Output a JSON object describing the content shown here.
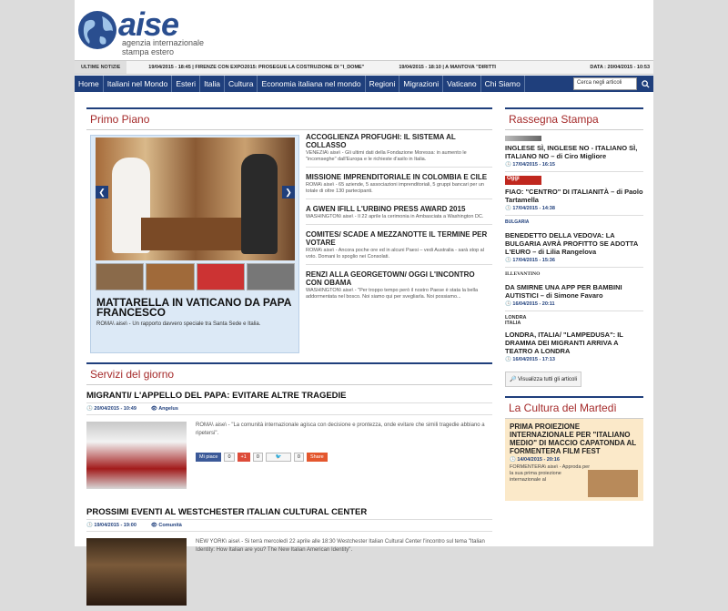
{
  "brand": {
    "name": "aise",
    "subtitle_line1": "agenzia internazionale",
    "subtitle_line2": "stampa estero"
  },
  "ticker": {
    "label": "ULTIME NOTIZIE",
    "items": [
      "19/04/2015 - 18:45 | FIRENZE CON EXPO2015: PROSEGUE LA COSTRUZIONE DI \"I_DOME\"",
      "19/04/2015 - 18:10 | A MANTOVA \"DIRITTI"
    ],
    "date_label": "DATA : 20/04/2015 - 10:53"
  },
  "nav": {
    "items": [
      "Home",
      "Italiani nel Mondo",
      "Esteri",
      "Italia",
      "Cultura",
      "Economia italiana nel mondo",
      "Regioni",
      "Migrazioni",
      "Vaticano",
      "Chi Siamo"
    ],
    "search_placeholder": "Cerca negli articoli"
  },
  "primo_piano": {
    "title": "Primo Piano",
    "featured": {
      "title": "MATTARELLA IN VATICANO DA PAPA FRANCESCO",
      "text": "ROMA\\ aise\\ - Un rapporto davvero speciale tra Santa Sede e Italia."
    },
    "news": [
      {
        "title": "ACCOGLIENZA PROFUGHI: IL SISTEMA AL COLLASSO",
        "text": "VENEZIA\\ aise\\ - Gli ultimi dati della Fondazione Moressa: in aumento le \"incomseghe\" dall'Europa e le richieste d'asilo in Italia."
      },
      {
        "title": "MISSIONE IMPRENDITORIALE IN COLOMBIA E CILE",
        "text": "ROMA\\ aise\\ - 65 aziende, 5 associazioni imprenditoriali, 5 gruppi bancari per un totale di oltre 130 partecipanti."
      },
      {
        "title": "A GWEN IFILL L'URBINO PRESS AWARD 2015",
        "text": "WASHINGTON\\ aise\\ - Il 22 aprile la cerimonia in Ambasciata a Washington DC."
      },
      {
        "title": "COMITES/ SCADE A MEZZANOTTE IL TERMINE PER VOTARE",
        "text": "ROMA\\ aise\\ - Ancora poche ore ed in alcuni Paesi – vedi Australia - sarà stop al voto. Domani lo spoglio nei Consolati."
      },
      {
        "title": "RENZI ALLA GEORGETOWN/ OGGI L'INCONTRO CON OBAMA",
        "text": "WASHINGTON\\ aise\\ - \"Per troppo tempo però il nostro Paese è stata la bella addormentata nel bosco. Noi siamo qui per svegliarla. Noi possiamo..."
      }
    ]
  },
  "servizi": {
    "title": "Servizi del giorno",
    "articles": [
      {
        "title": "MIGRANTI/ L'APPELLO DEL PAPA: EVITARE ALTRE TRAGEDIE",
        "date": "20/04/2015 - 10:49",
        "author": "Angelus",
        "text": "ROMA\\ aise\\ - \"La comunità internazionale agisca con decisione e prontezza, onde evitare che simili tragedie abbiano a ripetersi\".",
        "social": {
          "fb": "Mi piace",
          "fb_count": "0",
          "gp": "+1",
          "gp_count": "0",
          "tw_count": "0",
          "share": "Share"
        }
      },
      {
        "title": "PROSSIMI EVENTI AL WESTCHESTER ITALIAN CULTURAL CENTER",
        "date": "19/04/2015 - 19:00",
        "author": "Comunità",
        "text": "NEW YORK\\ aise\\ - Si terrà mercoledì 22 aprile alle 18:30 Westchester Italian Cultural Center l'incontro sul tema \"Italian Identity: How Italian are you? The New Italian American Identity\"."
      }
    ]
  },
  "rassegna": {
    "title": "Rassegna Stampa",
    "items": [
      {
        "logo": "",
        "title": "INGLESE SÌ, INGLESE NO - ITALIANO SÌ, ITALIANO NO – di Ciro Migliore",
        "date": "17/04/2015 - 16:15"
      },
      {
        "logo": "Oggi",
        "title": "FIAO: \"CENTRO\" DI ITALIANITÀ – di Paolo Tartamella",
        "date": "17/04/2015 - 14:38"
      },
      {
        "logo": "BULGARIA",
        "title": "BENEDETTO DELLA VEDOVA: LA BULGARIA AVRÀ PROFITTO SE ADOTTA L'EURO – di Lilia Rangelova",
        "date": "17/04/2015 - 15:36"
      },
      {
        "logo": "ILLEVANTINO",
        "title": "DA SMIRNE UNA APP PER BAMBINI AUTISTICI – di Simone Favaro",
        "date": "16/04/2015 - 20:11"
      },
      {
        "logo": "LONDRA ITALIA",
        "title": "LONDRA, ITALIA/ \"LAMPEDUSA\": IL DRAMMA DEI MIGRANTI ARRIVA A TEATRO A LONDRA",
        "date": "16/04/2015 - 17:13"
      }
    ],
    "all_button": "Visualizza tutti gli articoli"
  },
  "cultura": {
    "title": "La Cultura del Martedì",
    "item": {
      "title": "PRIMA PROIEZIONE INTERNAZIONALE PER \"ITALIANO MEDIO\" DI MACCIO CAPATONDA AL FORMENTERA FILM FEST",
      "date": "14/04/2015 - 20:16",
      "text": "FORMENTERA\\ aise\\ - Approda per la sua prima proiezione internazionale al"
    }
  }
}
